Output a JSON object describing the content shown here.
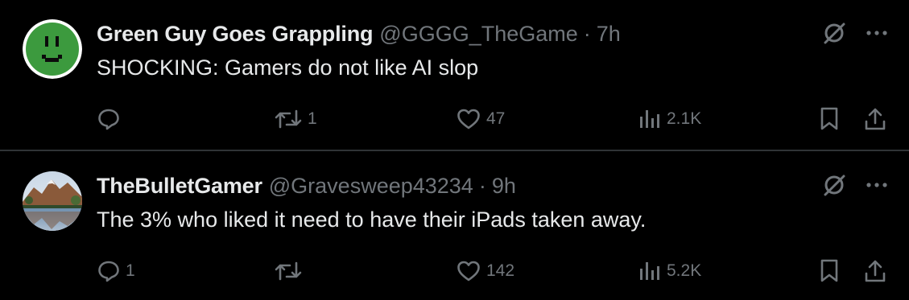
{
  "posts": [
    {
      "author_name": "Green Guy Goes Grappling",
      "handle": "@GGGG_TheGame",
      "separator": "·",
      "time": "7h",
      "text": "SHOCKING: Gamers do not like AI slop",
      "reply_count": "",
      "retweet_count": "1",
      "like_count": "47",
      "view_count": "2.1K",
      "avatar_color": "#3c9a3e"
    },
    {
      "author_name": "TheBulletGamer",
      "handle": "@Gravesweep43234",
      "separator": "·",
      "time": "9h",
      "text": "The 3% who liked it need to have their iPads taken away.",
      "reply_count": "1",
      "retweet_count": "",
      "like_count": "142",
      "view_count": "5.2K"
    }
  ],
  "icons": [
    "grok-icon",
    "more-icon",
    "reply-icon",
    "retweet-icon",
    "like-icon",
    "views-icon",
    "bookmark-icon",
    "share-icon"
  ],
  "colors": {
    "background": "#000000",
    "text": "#e7e9ea",
    "secondary": "#71767b",
    "divider": "#2f3336"
  }
}
